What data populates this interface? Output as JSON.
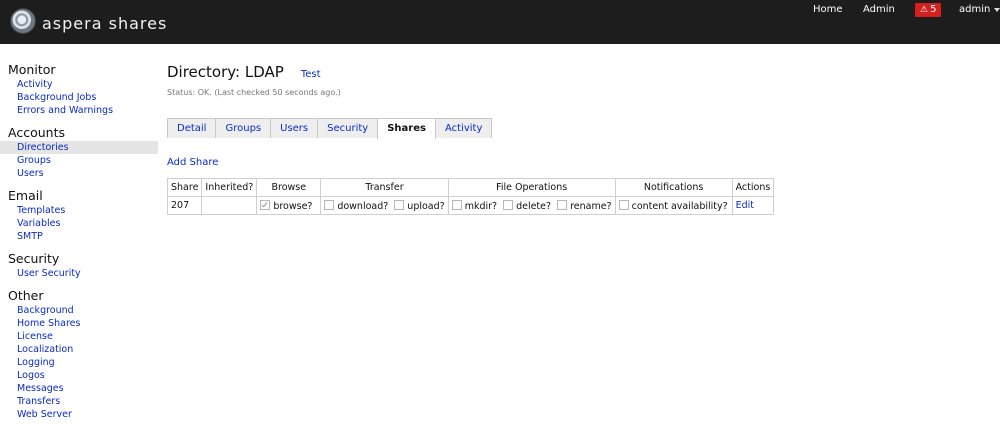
{
  "header": {
    "brand": "aspera shares",
    "nav": {
      "home": "Home",
      "admin": "Admin"
    },
    "alert_count": "5",
    "user": "admin"
  },
  "sidebar": {
    "sections": [
      {
        "title": "Monitor",
        "items": [
          "Activity",
          "Background Jobs",
          "Errors and Warnings"
        ]
      },
      {
        "title": "Accounts",
        "items": [
          "Directories",
          "Groups",
          "Users"
        ]
      },
      {
        "title": "Email",
        "items": [
          "Templates",
          "Variables",
          "SMTP"
        ]
      },
      {
        "title": "Security",
        "items": [
          "User Security"
        ]
      },
      {
        "title": "Other",
        "items": [
          "Background",
          "Home Shares",
          "License",
          "Localization",
          "Logging",
          "Logos",
          "Messages",
          "Transfers",
          "Web Server"
        ]
      }
    ],
    "active_item": "Directories"
  },
  "main": {
    "title": "Directory: LDAP",
    "test_link": "Test",
    "status": "Status: OK. (Last checked 50 seconds ago.)",
    "tabs": [
      "Detail",
      "Groups",
      "Users",
      "Security",
      "Shares",
      "Activity"
    ],
    "active_tab": "Shares",
    "add_share": "Add Share",
    "table": {
      "headers": [
        "Share",
        "Inherited?",
        "Browse",
        "Transfer",
        "File Operations",
        "Notifications",
        "Actions"
      ],
      "rows": [
        {
          "share": "207",
          "inherited": "",
          "browse": {
            "label": "browse?",
            "checked": true
          },
          "transfer": [
            {
              "label": "download?",
              "checked": false
            },
            {
              "label": "upload?",
              "checked": false
            }
          ],
          "file_operations": [
            {
              "label": "mkdir?",
              "checked": false
            },
            {
              "label": "delete?",
              "checked": false
            },
            {
              "label": "rename?",
              "checked": false
            }
          ],
          "notifications": {
            "label": "content availability?",
            "checked": false
          },
          "action": "Edit"
        }
      ]
    }
  }
}
